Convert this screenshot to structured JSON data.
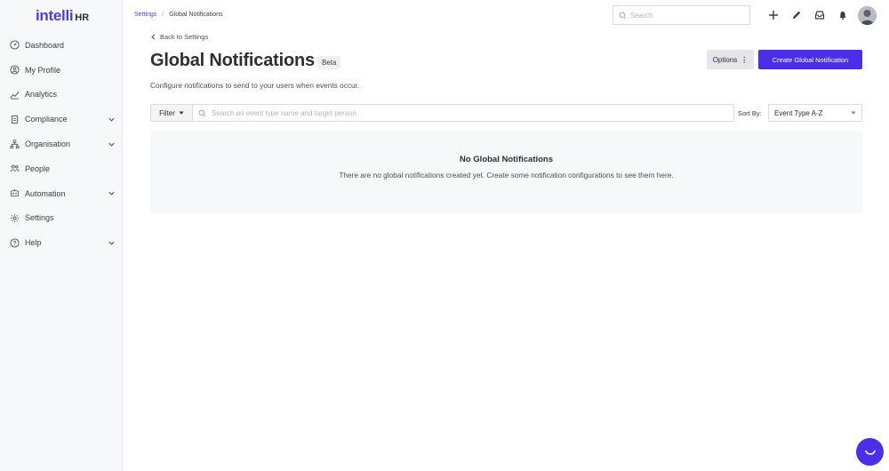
{
  "brand": {
    "logo_main": "intelli",
    "logo_suffix": "HR",
    "accent": "#4a2ee8"
  },
  "sidebar": {
    "items": [
      {
        "label": "Dashboard",
        "icon": "dashboard-icon",
        "expandable": false
      },
      {
        "label": "My Profile",
        "icon": "profile-icon",
        "expandable": false
      },
      {
        "label": "Analytics",
        "icon": "analytics-icon",
        "expandable": false
      },
      {
        "label": "Compliance",
        "icon": "compliance-icon",
        "expandable": true
      },
      {
        "label": "Organisation",
        "icon": "organisation-icon",
        "expandable": true
      },
      {
        "label": "People",
        "icon": "people-icon",
        "expandable": false
      },
      {
        "label": "Automation",
        "icon": "automation-icon",
        "expandable": true
      },
      {
        "label": "Settings",
        "icon": "gear-icon",
        "expandable": false
      },
      {
        "label": "Help",
        "icon": "help-icon",
        "expandable": true
      }
    ]
  },
  "breadcrumb": {
    "parent": "Settings",
    "separator": "/",
    "current": "Global Notifications"
  },
  "topbar": {
    "search_placeholder": "Search",
    "actions": [
      "plus-icon",
      "pencil-icon",
      "inbox-icon",
      "bell-icon"
    ]
  },
  "page": {
    "back_label": "Back to Settings",
    "title": "Global Notifications",
    "badge": "Beta",
    "subtitle": "Configure notifications to send to your users when events occur.",
    "options_label": "Options",
    "create_label": "Create Global Notification"
  },
  "filters": {
    "filter_label": "Filter",
    "search_placeholder": "Search on event type name and target person.",
    "sort_label": "Sort By:",
    "sort_value": "Event Type A-Z"
  },
  "empty_state": {
    "title": "No Global Notifications",
    "description": "There are no global notifications created yet. Create some notification configurations to see them here."
  }
}
